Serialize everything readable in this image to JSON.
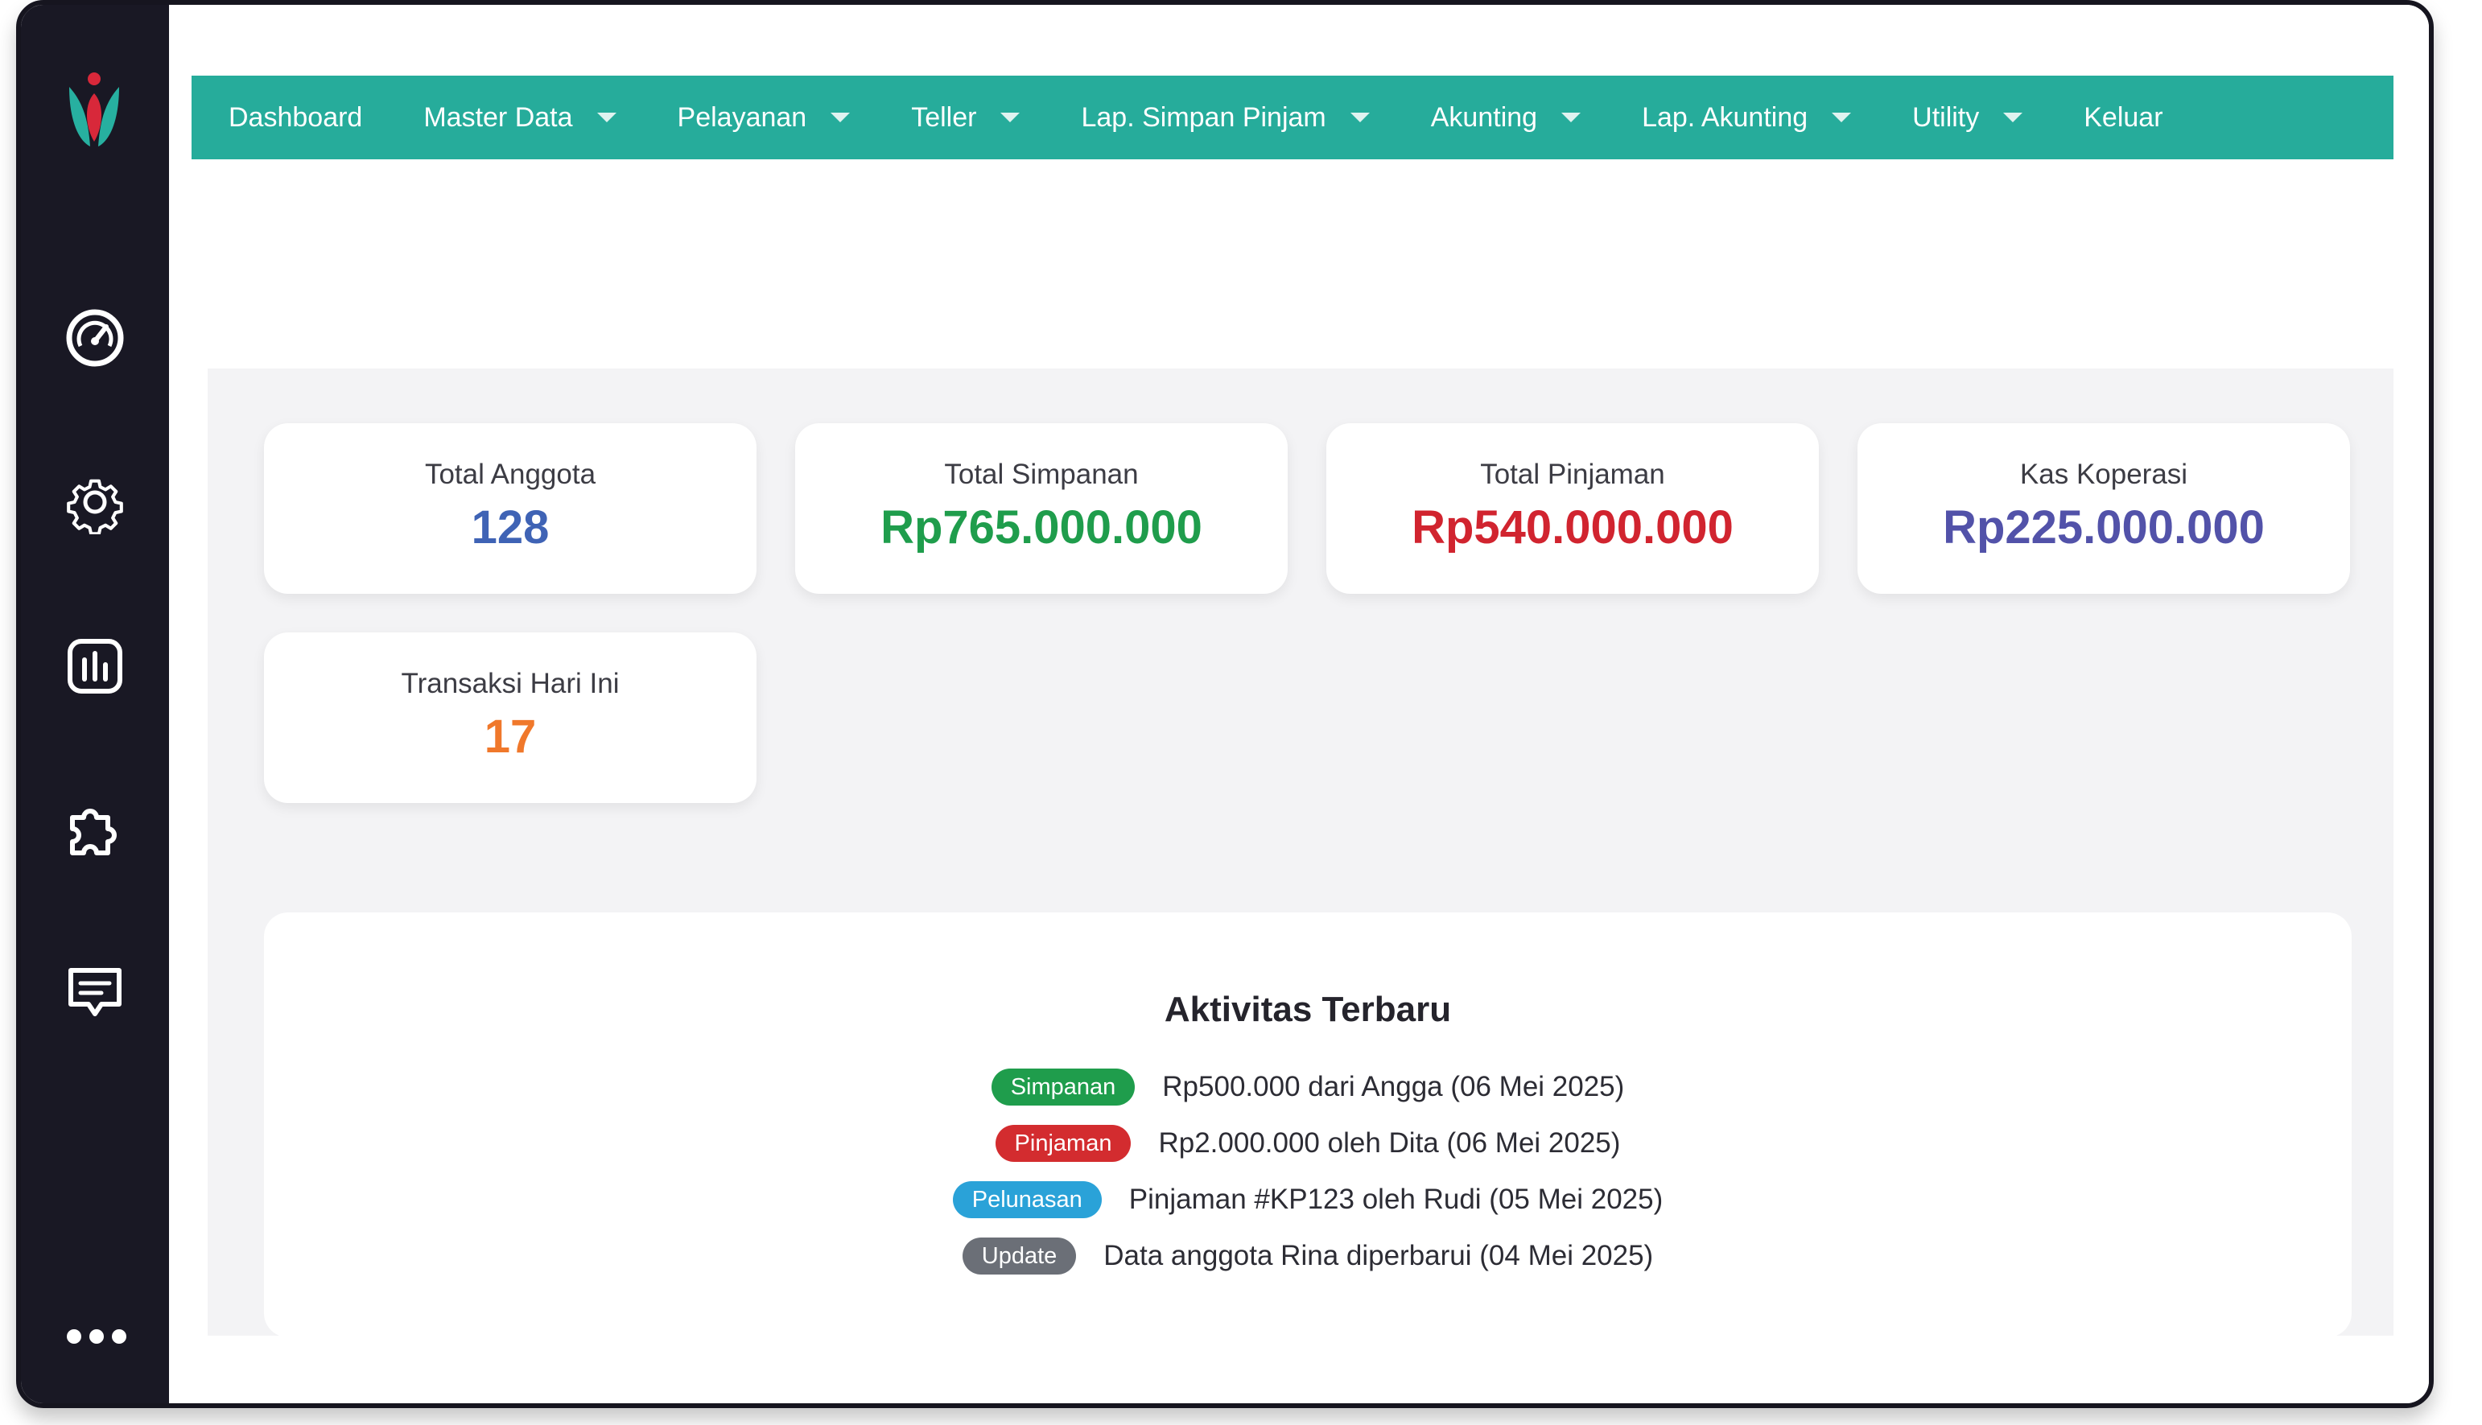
{
  "nav": {
    "items": [
      {
        "label": "Dashboard",
        "has_dropdown": false
      },
      {
        "label": "Master Data",
        "has_dropdown": true
      },
      {
        "label": "Pelayanan",
        "has_dropdown": true
      },
      {
        "label": "Teller",
        "has_dropdown": true
      },
      {
        "label": "Lap. Simpan Pinjam",
        "has_dropdown": true
      },
      {
        "label": "Akunting",
        "has_dropdown": true
      },
      {
        "label": "Lap. Akunting",
        "has_dropdown": true
      },
      {
        "label": "Utility",
        "has_dropdown": true
      },
      {
        "label": "Keluar",
        "has_dropdown": false
      }
    ],
    "color": "#26ac9b"
  },
  "sidebar": {
    "icons": [
      "dashboard-gauge-icon",
      "settings-gear-icon",
      "chart-icon",
      "puzzle-plugin-icon",
      "chat-message-icon"
    ],
    "more_icon": "more-dots-icon",
    "background": "#191824"
  },
  "stats": [
    {
      "label": "Total Anggota",
      "value": "128",
      "color": "#3f63b5"
    },
    {
      "label": "Total Simpanan",
      "value": "Rp765.000.000",
      "color": "#1f9d4c"
    },
    {
      "label": "Total Pinjaman",
      "value": "Rp540.000.000",
      "color": "#d1242f"
    },
    {
      "label": "Kas Koperasi",
      "value": "Rp225.000.000",
      "color": "#5252a9"
    },
    {
      "label": "Transaksi Hari Ini",
      "value": "17",
      "color": "#f0782b"
    }
  ],
  "activity": {
    "title": "Aktivitas Terbaru",
    "items": [
      {
        "badge": "Simpanan",
        "badge_color": "#1f9d4c",
        "text": "Rp500.000 dari Angga (06 Mei 2025)"
      },
      {
        "badge": "Pinjaman",
        "badge_color": "#d32c2f",
        "text": "Rp2.000.000 oleh Dita (06 Mei 2025)"
      },
      {
        "badge": "Pelunasan",
        "badge_color": "#2aa2d8",
        "text": "Pinjaman #KP123 oleh Rudi (05 Mei 2025)"
      },
      {
        "badge": "Update",
        "badge_color": "#6b6f77",
        "text": "Data anggota Rina diperbarui (04 Mei 2025)"
      }
    ]
  }
}
